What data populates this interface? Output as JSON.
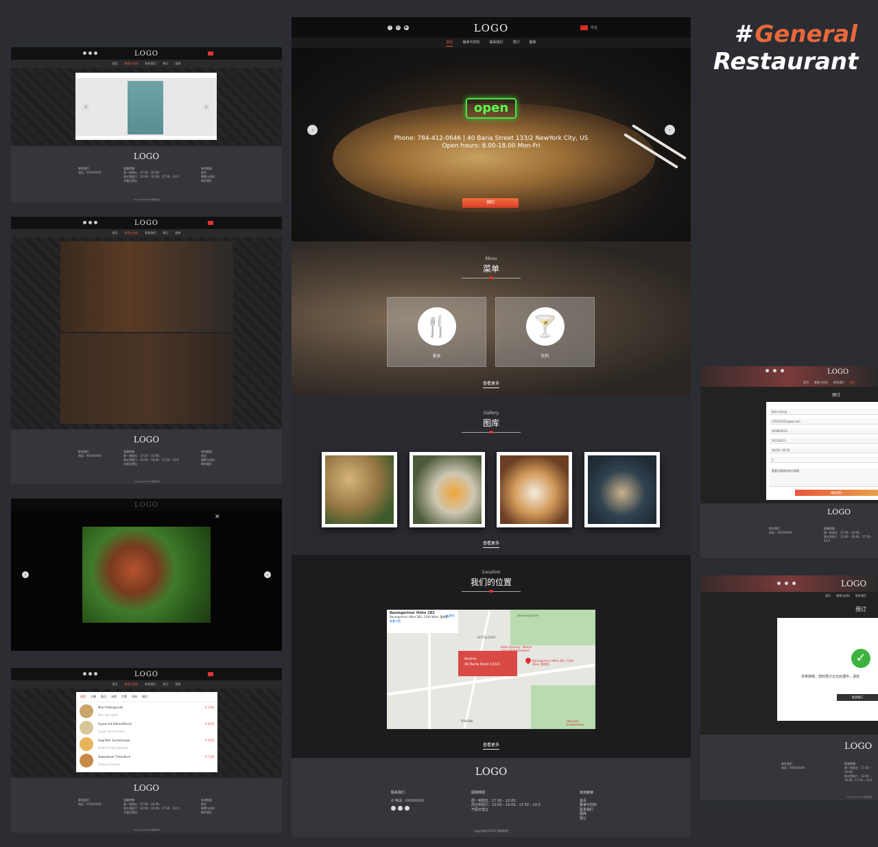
{
  "heading": {
    "hash": "#",
    "line1": "General",
    "line2": "Restaurant"
  },
  "brand": {
    "logo": "LOGO",
    "lang": "中文"
  },
  "nav": [
    "首页",
    "餐食与饮料",
    "联系我们",
    "预订",
    "图库"
  ],
  "hero": {
    "sign": "open",
    "info_line1": "Phone: 784-412-0646    |    40 Baria Street 133/2 NewYork City, US",
    "info_line2": "Open hours: 8.00-18.00 Mon-Fri",
    "cta": "预约"
  },
  "menu_section": {
    "en": "Menu",
    "cn": "菜单",
    "cards": [
      {
        "label": "餐食",
        "icon": "cutlery-icon"
      },
      {
        "label": "饮料",
        "icon": "cocktail-icon"
      }
    ],
    "more": "查看更多"
  },
  "gallery_section": {
    "en": "Gallery",
    "cn": "图库",
    "more": "查看更多"
  },
  "location_section": {
    "en": "Location",
    "cn": "我们的位置",
    "more": "查看更多",
    "map": {
      "place": "Baumgartner Höhe 282",
      "address": "Baumgartner Höhe 282, 1140 Wien, 奥地利",
      "bigger_map": "查看大图",
      "route": "路线",
      "box_country": "Austria",
      "box_street": "40 Baria Sreet 133/2",
      "pin_label": "Baumgartner Höhe 282, 1140 Wien, 奥地利",
      "klinik": "Klinik Penzing - Wiener Gesundheitsverbund",
      "steinhof": "Steinhofgründe",
      "hutteldorf": "HÜTTELDORF",
      "penzing": "PENZING",
      "hanusch": "Hanusch-Krankenhaus"
    }
  },
  "footer": {
    "logo": "LOGO",
    "contact_h": "联系我们",
    "phone": "电话：XXXXXXXX",
    "hours_h": "經營時間",
    "hours1": "周一到周五：17:30 – 22:00,",
    "hours2": "周五到周六：12:00 – 16:00、17:30 – 22:0",
    "hours3": "节假日营业",
    "links_h": "有用链接",
    "links": [
      "首页",
      "餐食与饮料",
      "联系我们",
      "图库",
      "预订"
    ],
    "copyright": "copyright©2022 搜锐科技"
  },
  "shot4_menu": {
    "tabs": [
      "前菜",
      "主餐",
      "面点",
      "汤类",
      "主食",
      "饮料",
      "甜点"
    ],
    "items": [
      {
        "name": "Mini Frühlingsrolle",
        "sub": "Mini Springroll",
        "price": "€ 3.00"
      },
      {
        "name": "Gyoza mit Hühnerfleisch",
        "sub": "Gyoza with Chicken",
        "price": "€ 8.50"
      },
      {
        "name": "Gegrillter Garnelenspie",
        "sub": "Grilled Prawn Skewers",
        "price": "€ 9.50"
      },
      {
        "name": "Gebackener Tintenfisch",
        "sub": "Tempura Prawns",
        "price": "€ 7.50"
      }
    ]
  },
  "booking": {
    "title": "预订",
    "fields": [
      "Bulin Dong",
      "435325051@qq.com",
      "393892023",
      "2022/4/13",
      "18:00~18:30",
      "2"
    ],
    "note": "需要包厢莱的座位谢谢",
    "submit": "确定预约"
  },
  "confirm": {
    "title": "预订",
    "message": "非常感谢，您的预订正在处理中，请您",
    "cancel": "取消预订"
  },
  "colors": {
    "accent": "#e8563a",
    "footer": "#37353b",
    "header": "#0e0e0f"
  }
}
